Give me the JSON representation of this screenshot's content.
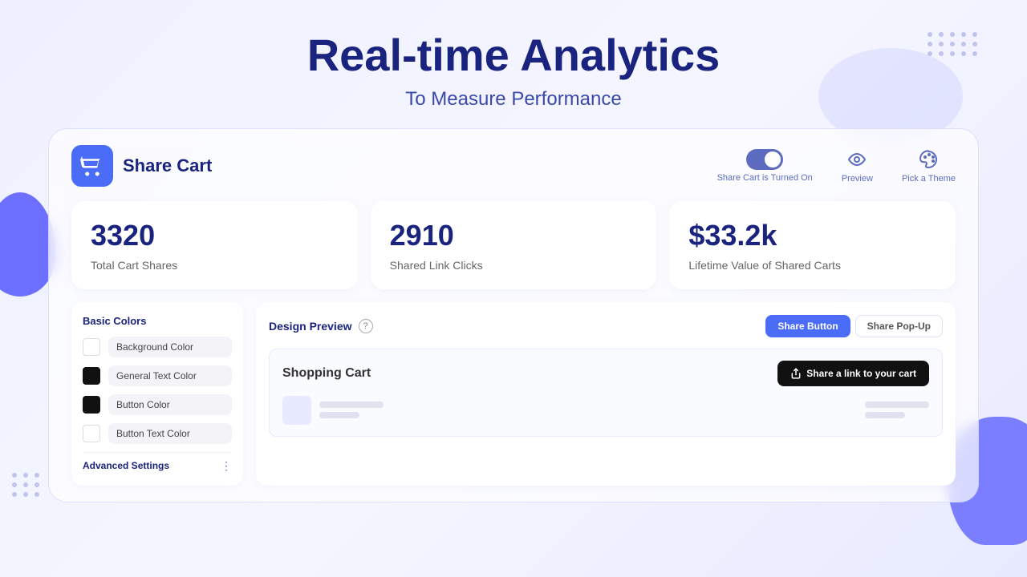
{
  "header": {
    "title": "Real-time Analytics",
    "subtitle": "To Measure Performance"
  },
  "app": {
    "name": "Share Cart",
    "toggle_label": "Share Cart is Turned On",
    "preview_label": "Preview",
    "theme_label": "Pick a Theme"
  },
  "stats": [
    {
      "value": "3320",
      "label": "Total Cart Shares"
    },
    {
      "value": "2910",
      "label": "Shared Link Clicks"
    },
    {
      "value": "$33.2k",
      "label": "Lifetime Value of Shared Carts"
    }
  ],
  "colors": {
    "section_title": "Basic Colors",
    "items": [
      {
        "label": "Background Color",
        "swatch": "white"
      },
      {
        "label": "General Text Color",
        "swatch": "black"
      },
      {
        "label": "Button Color",
        "swatch": "black"
      },
      {
        "label": "Button Text Color",
        "swatch": "white"
      }
    ],
    "advanced_label": "Advanced Settings"
  },
  "design_preview": {
    "title": "Design Preview",
    "tabs": [
      {
        "label": "Share Button",
        "active": true
      },
      {
        "label": "Share Pop-Up",
        "active": false
      }
    ],
    "cart_title": "Shopping Cart",
    "share_btn_label": "Share a link to your cart"
  }
}
